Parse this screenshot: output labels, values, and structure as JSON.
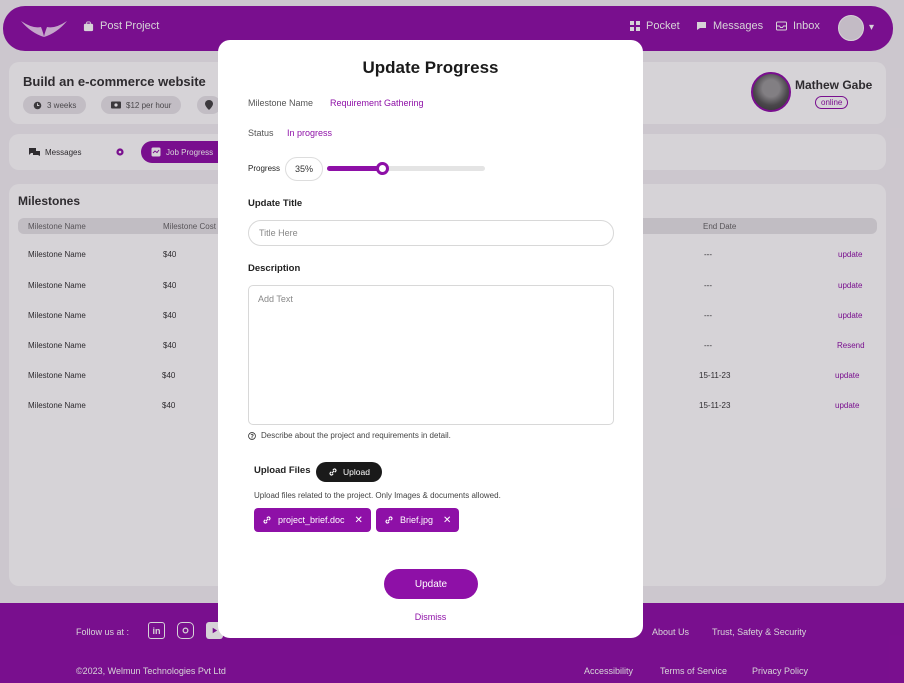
{
  "nav": {
    "post_project": "Post Project",
    "pocket": "Pocket",
    "messages": "Messages",
    "inbox": "Inbox"
  },
  "job": {
    "title": "Build an e-commerce website",
    "duration": "3 weeks",
    "rate": "$12 per hour"
  },
  "profile": {
    "name": "Mathew Gabe",
    "status": "online"
  },
  "tabs": {
    "messages": "Messages",
    "job_progress": "Job Progress"
  },
  "milestones": {
    "title": "Milestones",
    "headers": [
      "Milestone Name",
      "Milestone Cost",
      "End Date"
    ],
    "rows": [
      {
        "name": "Milestone Name",
        "cost": "$40",
        "end_date": "---",
        "action": "update"
      },
      {
        "name": "Milestone Name",
        "cost": "$40",
        "end_date": "---",
        "action": "update"
      },
      {
        "name": "Milestone Name",
        "cost": "$40",
        "end_date": "---",
        "action": "update"
      },
      {
        "name": "Milestone Name",
        "cost": "$40",
        "end_date": "---",
        "action": "Resend"
      },
      {
        "name": "Milestone Name",
        "cost": "$40",
        "end_date": "15-11-23",
        "action": "update"
      },
      {
        "name": "Milestone Name",
        "cost": "$40",
        "end_date": "15-11-23",
        "action": "update"
      }
    ]
  },
  "footer": {
    "follow_us": "Follow us at :",
    "about_us": "About Us",
    "trust": "Trust, Safety & Security",
    "copyright": "©2023, Welmun Technologies Pvt Ltd",
    "accessibility": "Accessibility",
    "terms": "Terms of Service",
    "privacy": "Privacy Policy"
  },
  "modal": {
    "title": "Update Progress",
    "milestone_label": "Milestone Name",
    "milestone_value": "Requirement Gathering",
    "status_label": "Status",
    "status_value": "In progress",
    "progress_label": "Progress",
    "progress_value": "35%",
    "progress_fraction": 0.35,
    "update_title_label": "Update Title",
    "title_placeholder": "Title Here",
    "description_label": "Description",
    "description_placeholder": "Add Text",
    "hint": "Describe about the project and requirements in detail.",
    "upload_label": "Upload Files",
    "upload_button": "Upload",
    "upload_note": "Upload files related to the project. Only Images & documents allowed.",
    "files": [
      "project_brief.doc",
      "Brief.jpg"
    ],
    "update_button": "Update",
    "dismiss_button": "Dismiss"
  },
  "colors": {
    "brand": "#8e10a7",
    "dark": "#1a1a1a"
  }
}
